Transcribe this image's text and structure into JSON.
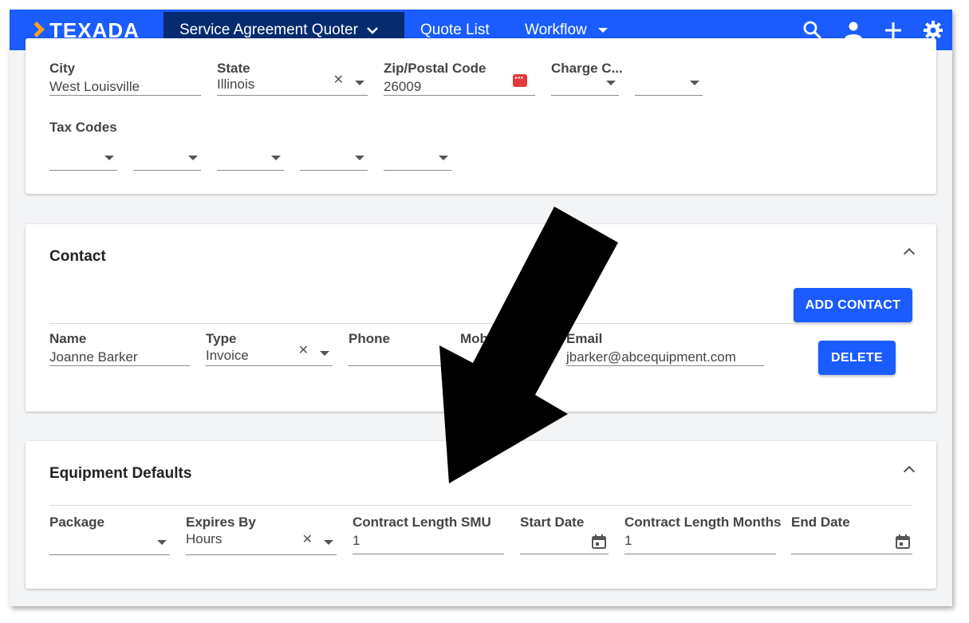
{
  "header": {
    "logo_text": "TEXADA",
    "nav_active": "Service Agreement Quoter",
    "nav_quote_list": "Quote List",
    "nav_workflow": "Workflow"
  },
  "address": {
    "city_label": "City",
    "city_value": "West Louisville",
    "state_label": "State",
    "state_value": "Illinois",
    "zip_label": "Zip/Postal Code",
    "zip_value": "26009",
    "charge_label": "Charge C...",
    "tax_label": "Tax Codes"
  },
  "contact": {
    "title": "Contact",
    "add_button": "ADD CONTACT",
    "name_label": "Name",
    "name_value": "Joanne Barker",
    "type_label": "Type",
    "type_value": "Invoice",
    "phone_label": "Phone",
    "mobile_label": "Mob",
    "email_label": "Email",
    "email_value": "jbarker@abcequipment.com",
    "delete_button": "DELETE"
  },
  "equipment": {
    "title": "Equipment Defaults",
    "package_label": "Package",
    "expires_label": "Expires By",
    "expires_value": "Hours",
    "smu_label": "Contract Length SMU",
    "smu_value": "1",
    "start_label": "Start Date",
    "months_label": "Contract Length Months",
    "months_value": "1",
    "end_label": "End Date"
  },
  "colors": {
    "brand_blue": "#1a5cff",
    "nav_active_bg": "#062a6e",
    "logo_accent": "#f7a21b"
  },
  "icons": [
    "search-icon",
    "user-icon",
    "plus-icon",
    "gear-icon",
    "chevron-down-icon",
    "calendar-icon",
    "password-icon",
    "clear-icon",
    "collapse-icon"
  ]
}
